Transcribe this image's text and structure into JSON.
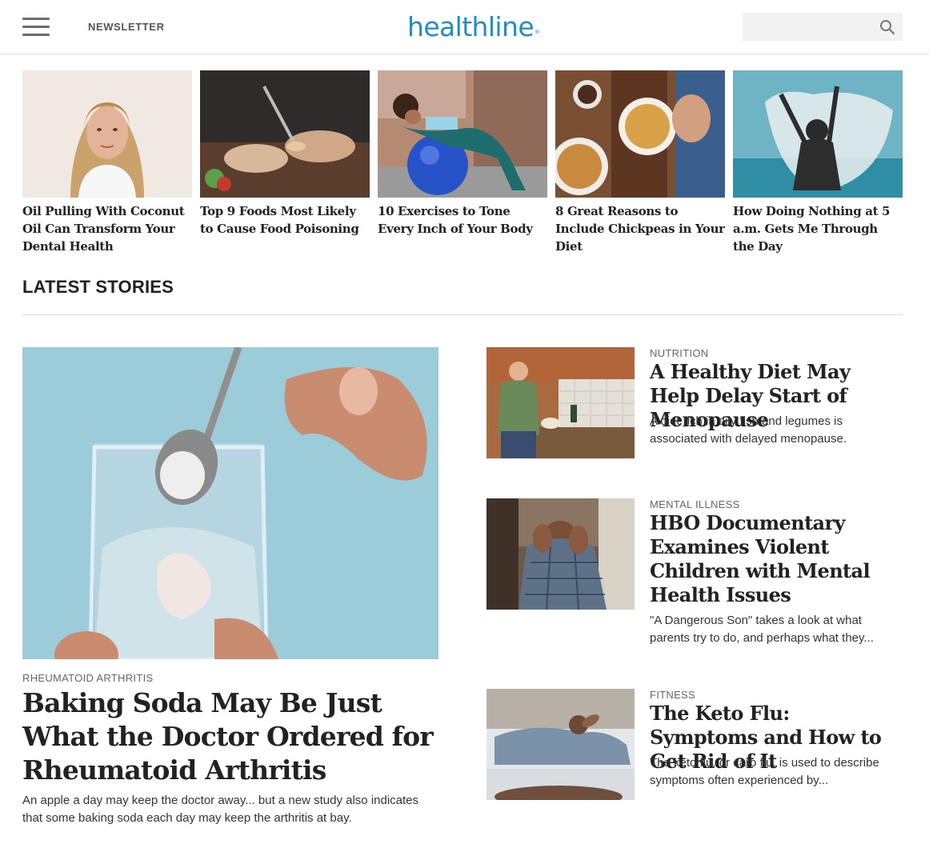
{
  "header": {
    "newsletter_label": "NEWSLETTER",
    "logo_text": "healthline",
    "logo_mark": "®",
    "search_placeholder": "",
    "brand_color": "#1d8fc7"
  },
  "top_stories": [
    {
      "title": "Oil Pulling With Coconut Oil Can Transform Your Dental Health"
    },
    {
      "title": "Top 9 Foods Most Likely to Cause Food Poisoning"
    },
    {
      "title": "10 Exercises to Tone Every Inch of Your Body"
    },
    {
      "title": "8 Great Reasons to Include Chickpeas in Your Diet"
    },
    {
      "title": "How Doing Nothing at 5 a.m. Gets Me Through the Day"
    }
  ],
  "latest": {
    "heading": "LATEST STORIES",
    "feature": {
      "category": "RHEUMATOID ARTHRITIS",
      "title": "Baking Soda May Be Just What the Doctor Ordered for Rheumatoid Arthritis",
      "description": "An apple a day may keep the doctor away... but a new study also indicates that some baking soda each day may keep the arthritis at bay."
    },
    "side": [
      {
        "category": "NUTRITION",
        "title": "A Healthy Diet May Help Delay Start of Menopause",
        "description": "A diet rich in oily fish and legumes is associated with delayed menopause."
      },
      {
        "category": "MENTAL ILLNESS",
        "title": "HBO Documentary Examines Violent Children with Mental Health Issues",
        "description": "\"A Dangerous Son\" takes a look at what parents try to do, and perhaps what they..."
      },
      {
        "category": "FITNESS",
        "title": "The Keto Flu: Symptoms and How to Get Rid of It",
        "description": "The keto flu, or carb flu, is used to describe symptoms often experienced by..."
      }
    ]
  }
}
